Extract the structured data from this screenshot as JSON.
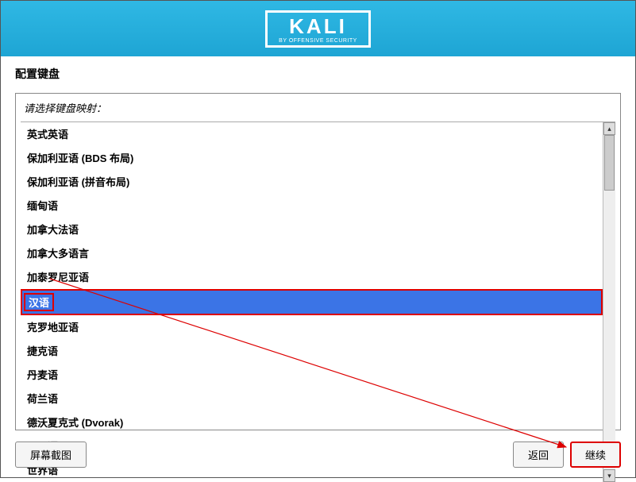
{
  "header": {
    "logo_text": "KALI",
    "logo_sub": "BY OFFENSIVE SECURITY"
  },
  "title": "配置键盘",
  "prompt": "请选择键盘映射：",
  "keyboard_items": [
    "英式英语",
    "保加利亚语 (BDS 布局)",
    "保加利亚语 (拼音布局)",
    "缅甸语",
    "加拿大法语",
    "加拿大多语言",
    "加泰罗尼亚语",
    "汉语",
    "克罗地亚语",
    "捷克语",
    "丹麦语",
    "荷兰语",
    "德沃夏克式 (Dvorak)",
    "不丹语",
    "世界语"
  ],
  "selected_index": 7,
  "footer": {
    "screenshot": "屏幕截图",
    "back": "返回",
    "continue": "继续"
  }
}
